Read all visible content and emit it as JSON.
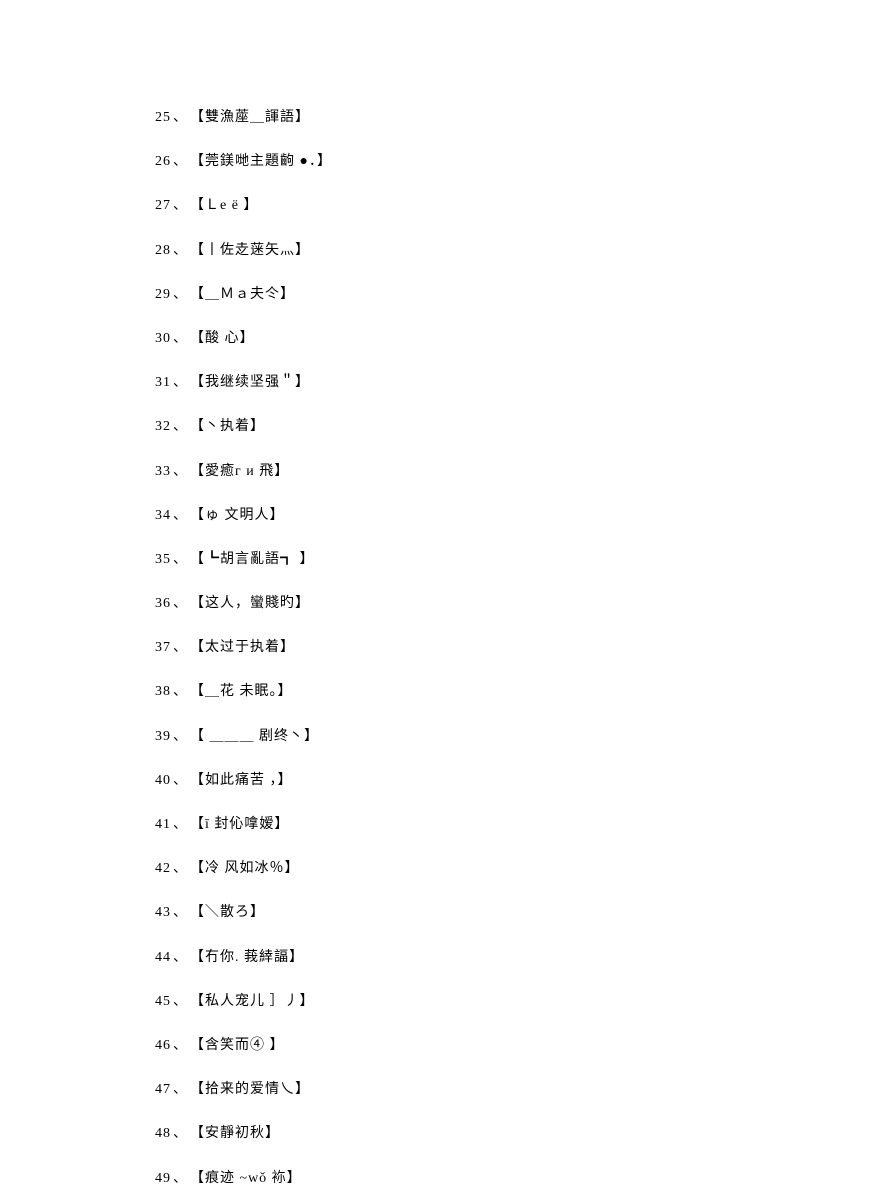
{
  "items": [
    {
      "num": "25",
      "sep": "、",
      "text": "【雙漁蓙＿諢語】"
    },
    {
      "num": "26",
      "sep": "、",
      "text": "【莞鎂哋主題齣  ●．】"
    },
    {
      "num": "27",
      "sep": "、",
      "text": "【Ｌе ё 】"
    },
    {
      "num": "28",
      "sep": "、",
      "text": "【丨佐赱蒾矢灬】"
    },
    {
      "num": "29",
      "sep": "、",
      "text": "【＿Ｍａ夫仒】"
    },
    {
      "num": "30",
      "sep": "、",
      "text": "【酸  心】"
    },
    {
      "num": "31",
      "sep": "、",
      "text": "【我继续坚强＂】"
    },
    {
      "num": "32",
      "sep": "、",
      "text": "【丶执着】"
    },
    {
      "num": "33",
      "sep": "、",
      "text": "【愛癒г  и 飛】"
    },
    {
      "num": "34",
      "sep": "、",
      "text": "【ゅ  文明人】"
    },
    {
      "num": "35",
      "sep": "、",
      "text": "【┗胡言亂語┓ 】"
    },
    {
      "num": "36",
      "sep": "、",
      "text": "【这人，蠻賤旳】"
    },
    {
      "num": "37",
      "sep": "、",
      "text": "【太过于执着】"
    },
    {
      "num": "38",
      "sep": "、",
      "text": "【＿花  未眠。】"
    },
    {
      "num": "39",
      "sep": "、",
      "text": "【 ＿＿＿  剧终丶】"
    },
    {
      "num": "40",
      "sep": "、",
      "text": "【如此痛苦 ，】"
    },
    {
      "num": "41",
      "sep": "、",
      "text": "【ī 封伈嗱嫒】"
    },
    {
      "num": "42",
      "sep": "、",
      "text": "【冷  风如冰％】"
    },
    {
      "num": "43",
      "sep": "、",
      "text": "【＼散ろ】"
    },
    {
      "num": "44",
      "sep": "、",
      "text": "【冇你. 莪緈諨】"
    },
    {
      "num": "45",
      "sep": "、",
      "text": "【私人宠儿 ］丿】"
    },
    {
      "num": "46",
      "sep": "、",
      "text": "【含笑而④ 】"
    },
    {
      "num": "47",
      "sep": "、",
      "text": "【拾来的爱情乀】"
    },
    {
      "num": "48",
      "sep": "、",
      "text": "【安靜初秋】"
    },
    {
      "num": "49",
      "sep": "、",
      "text": "【痕迹 ~wǒ 袮】"
    }
  ]
}
